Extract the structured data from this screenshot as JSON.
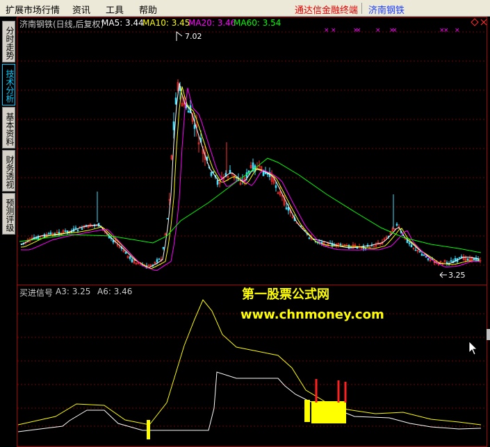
{
  "menu": {
    "items": [
      "扩展市场行情",
      "资讯",
      "工具",
      "帮助"
    ],
    "brand": "通达信金融终端",
    "stock": "济南钢铁"
  },
  "sidebar": {
    "tabs": [
      "分时走势",
      "技术分析",
      "基本资料",
      "财务透视",
      "预测评级"
    ],
    "active": 1
  },
  "price_panel": {
    "title": "济南钢铁(日线,后复权)",
    "ma": [
      {
        "label": "MA5: 3.44",
        "color": "#ffffff"
      },
      {
        "label": "MA10: 3.45",
        "color": "#ffff00"
      },
      {
        "label": "MA20: 3.46",
        "color": "#ff00ff"
      },
      {
        "label": "MA60: 3.54",
        "color": "#00ff00"
      }
    ],
    "high_label": "7.02",
    "low_label": "3.25"
  },
  "indicator_panel": {
    "title": "买进信号",
    "a3": "A3: 3.25",
    "a6": "A6: 3.46"
  },
  "watermark": {
    "line1": "第一股票公式网",
    "line2": "www.chnmoney.com"
  },
  "colors": {
    "up": "#ff3030",
    "down": "#40e0ff",
    "ma5": "#ffffff",
    "ma10": "#ffff00",
    "ma20": "#ff00ff",
    "ma60": "#00ff00",
    "signal": "#ffff00",
    "grid": "#7a0000"
  }
}
